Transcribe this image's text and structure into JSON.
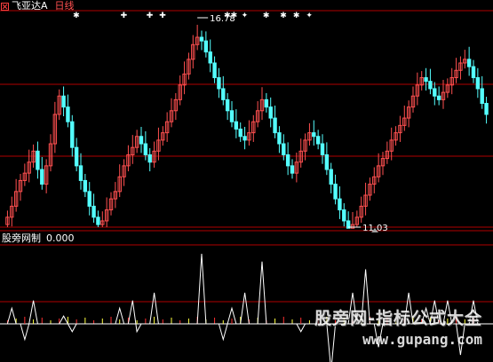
{
  "header": {
    "stock_name": "飞亚达A",
    "period": "日线"
  },
  "price_panel": {
    "high_label": "16.78",
    "low_label": "11.03",
    "signal_marks": [
      "✱",
      "✚",
      "✚",
      "✚",
      "✱✱",
      "✦",
      "✱",
      "✱",
      "✱",
      "✦"
    ]
  },
  "indicator": {
    "name": "股旁网制",
    "value": "0.000"
  },
  "watermark": {
    "title": "股旁网-指标公式大全",
    "url": "www.gupang.com"
  },
  "colors": {
    "up_candle": "#ff5050",
    "down_candle": "#54ffff",
    "grid_line": "#b00000",
    "indicator_line": "#ffffff",
    "bar_red": "#ff3030",
    "bar_yellow": "#ffff40"
  },
  "chart_data": {
    "type": "candlestick",
    "price_high": 16.78,
    "price_low": 11.03,
    "closes": [
      11.3,
      11.6,
      12.0,
      12.3,
      12.5,
      12.8,
      13.1,
      12.6,
      12.2,
      12.7,
      13.3,
      14.1,
      14.6,
      14.3,
      13.9,
      13.2,
      12.7,
      12.3,
      12.0,
      11.6,
      11.3,
      11.1,
      11.2,
      11.5,
      11.8,
      12.0,
      12.4,
      12.7,
      13.0,
      13.2,
      13.5,
      13.3,
      13.0,
      12.8,
      13.1,
      13.4,
      13.6,
      13.9,
      14.2,
      14.5,
      14.9,
      15.2,
      15.6,
      16.0,
      16.2,
      16.1,
      15.8,
      15.5,
      15.1,
      14.8,
      14.5,
      14.2,
      13.9,
      13.7,
      13.5,
      13.4,
      13.6,
      13.9,
      14.2,
      14.5,
      14.3,
      14.0,
      13.6,
      13.3,
      13.0,
      12.7,
      12.5,
      12.8,
      13.1,
      13.4,
      13.6,
      13.5,
      13.3,
      13.0,
      12.6,
      12.2,
      11.8,
      11.5,
      11.2,
      11.0,
      11.1,
      11.3,
      11.6,
      11.9,
      12.2,
      12.4,
      12.7,
      12.9,
      13.1,
      13.4,
      13.6,
      13.8,
      14.0,
      14.3,
      14.6,
      14.9,
      15.1,
      15.0,
      14.8,
      14.6,
      14.5,
      14.7,
      14.9,
      15.1,
      15.3,
      15.5,
      15.6,
      15.4,
      15.1,
      14.8,
      14.4,
      14.1
    ],
    "indicator_values": [
      0,
      2,
      0,
      0,
      -2,
      0,
      3,
      0,
      0,
      0,
      0,
      0,
      0,
      1,
      0,
      -1,
      0,
      0,
      0,
      0,
      0,
      0,
      0,
      0,
      0,
      0,
      2,
      0,
      0,
      3,
      -1,
      0,
      0,
      0,
      4,
      0,
      0,
      0,
      0,
      0,
      0,
      0,
      0,
      0,
      0,
      9,
      0,
      0,
      0,
      0,
      -2,
      0,
      2,
      0,
      0,
      4,
      0,
      0,
      0,
      8,
      0,
      0,
      0,
      0,
      0,
      0,
      0,
      0,
      -1,
      0,
      0,
      0,
      0,
      0,
      0,
      -6,
      0,
      0,
      0,
      0,
      4,
      0,
      0,
      7,
      0,
      0,
      -3,
      0,
      0,
      0,
      0,
      0,
      0,
      4,
      0,
      0,
      0,
      2,
      0,
      3,
      0,
      0,
      3,
      0,
      0,
      -4,
      0,
      0,
      3,
      0
    ]
  }
}
